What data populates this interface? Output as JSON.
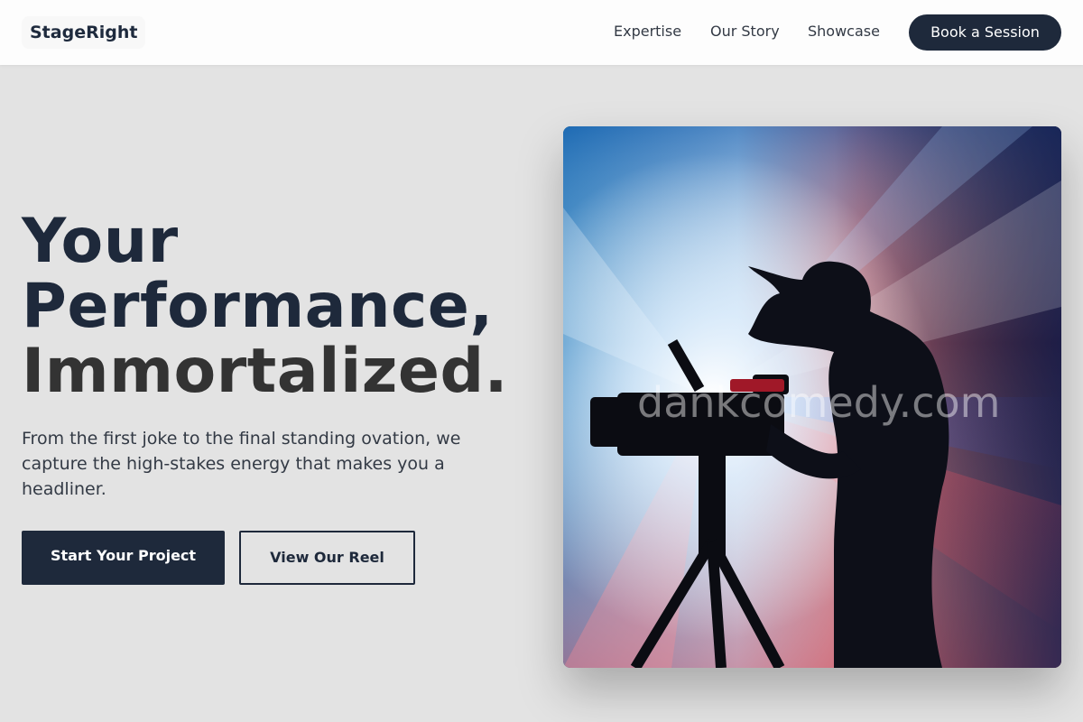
{
  "brand": {
    "name": "StageRight"
  },
  "nav": {
    "links": [
      {
        "label": "Expertise"
      },
      {
        "label": "Our Story"
      },
      {
        "label": "Showcase"
      }
    ],
    "cta_label": "Book a Session"
  },
  "hero": {
    "title_lines": [
      "Your",
      "Performance,",
      "Immortalized."
    ],
    "subtitle": "From the first joke to the final standing ovation, we capture the high-stakes energy that makes you a headliner.",
    "primary_button": "Start Your Project",
    "secondary_button": "View Our Reel",
    "image": {
      "description_icon": "camera-operator-photo",
      "watermark": "dankcomedy.com"
    }
  },
  "colors": {
    "navy": "#1e293b",
    "page_background": "#e3e3e3",
    "nav_background": "#fdfdfd",
    "text_dark": "#333a45"
  }
}
